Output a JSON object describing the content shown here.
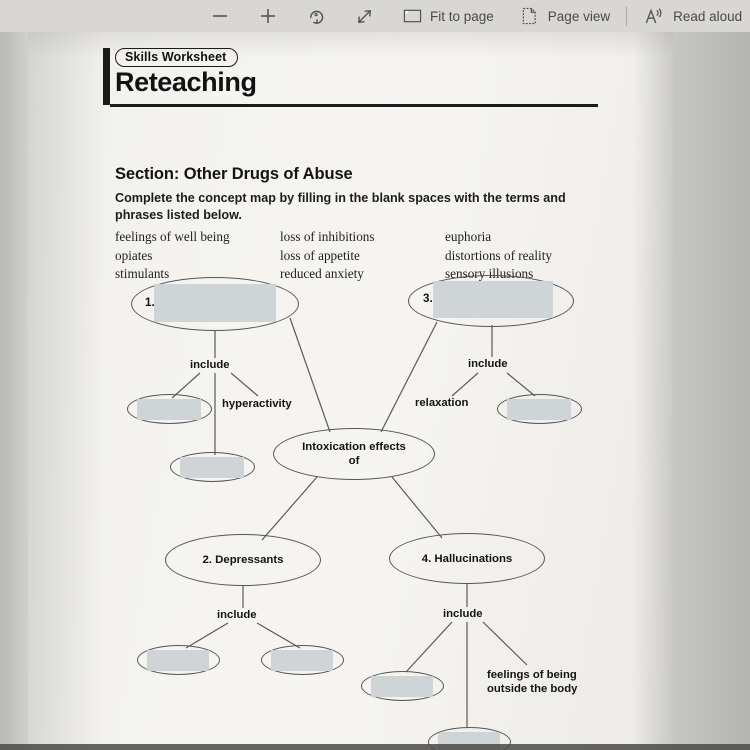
{
  "toolbar": {
    "zoom_out_label": "—",
    "zoom_in_label": "+",
    "rotate_label": "",
    "expand_label": "",
    "fit_to_page_label": "Fit to page",
    "page_view_label": "Page view",
    "read_aloud_label": "Read aloud",
    "read_aloud_glyph": "A"
  },
  "worksheet": {
    "badge": "Skills Worksheet",
    "title": "Reteaching",
    "section_title": "Section: Other Drugs of Abuse",
    "instructions": "Complete the concept map by filling in the blank spaces with the terms and phrases listed below.",
    "word_bank": {
      "column1": [
        "feelings of well being",
        "opiates",
        "stimulants"
      ],
      "column2": [
        "loss of inhibitions",
        "loss of appetite",
        "reduced anxiety"
      ],
      "column3": [
        "euphoria",
        "distortions of reality",
        "sensory illusions"
      ]
    }
  },
  "concept_map": {
    "center_node": "Intoxication effects\nof",
    "center_line1": "Intoxication effects",
    "center_line2": "of",
    "node1_number": "1.",
    "node3_number": "3.",
    "node2_label": "2. Depressants",
    "node4_label": "4. Hallucinations",
    "edge_label_include": "include",
    "term_hyperactivity": "hyperactivity",
    "term_relaxation": "relaxation",
    "term_outside_body_line1": "feelings of being",
    "term_outside_body_line2": "outside the body",
    "blank_fill_color": "#ccd2d5",
    "outline_color": "#565654"
  }
}
